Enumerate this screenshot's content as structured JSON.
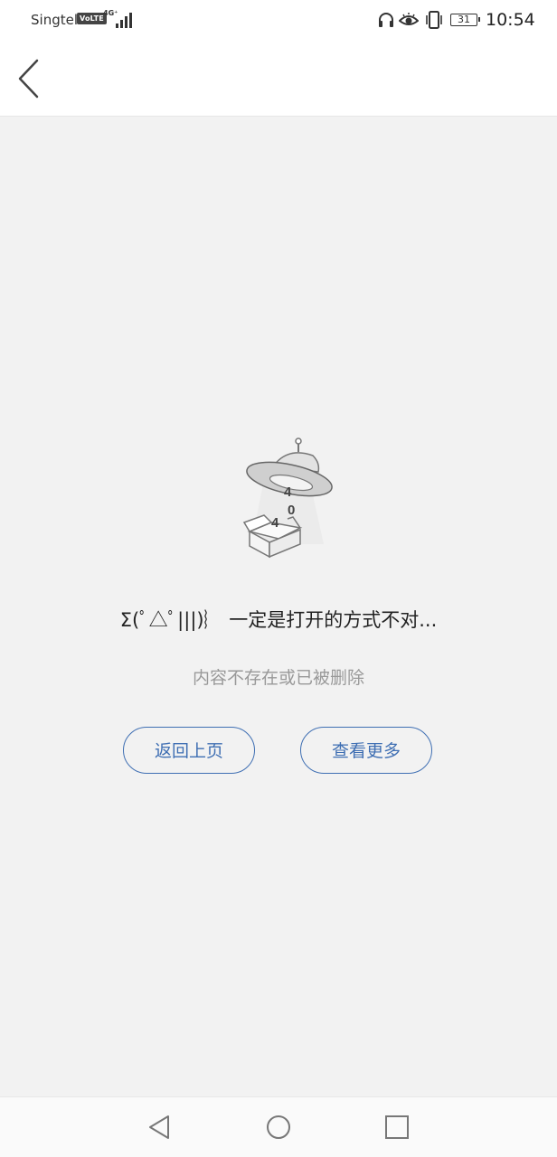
{
  "status_bar": {
    "carrier": "Singtel",
    "volte": "VoLTE",
    "network": "4G⁺",
    "battery": "31",
    "time": "10:54"
  },
  "icons": {
    "back": "chevron-left-icon",
    "headphones": "headphones-icon",
    "eye": "eye-icon",
    "vibrate": "vibrate-icon",
    "nav_back": "triangle-back-icon",
    "nav_home": "circle-home-icon",
    "nav_recents": "square-recents-icon"
  },
  "error": {
    "illustration_digits": [
      "4",
      "0",
      "4"
    ],
    "title": "Σ(ﾟ△ﾟ|||)︴ 一定是打开的方式不对...",
    "subtitle": "内容不存在或已被删除"
  },
  "actions": {
    "back_label": "返回上页",
    "more_label": "查看更多"
  },
  "colors": {
    "accent": "#3f6fb3",
    "background": "#f2f2f2",
    "subtitle": "#999999"
  }
}
